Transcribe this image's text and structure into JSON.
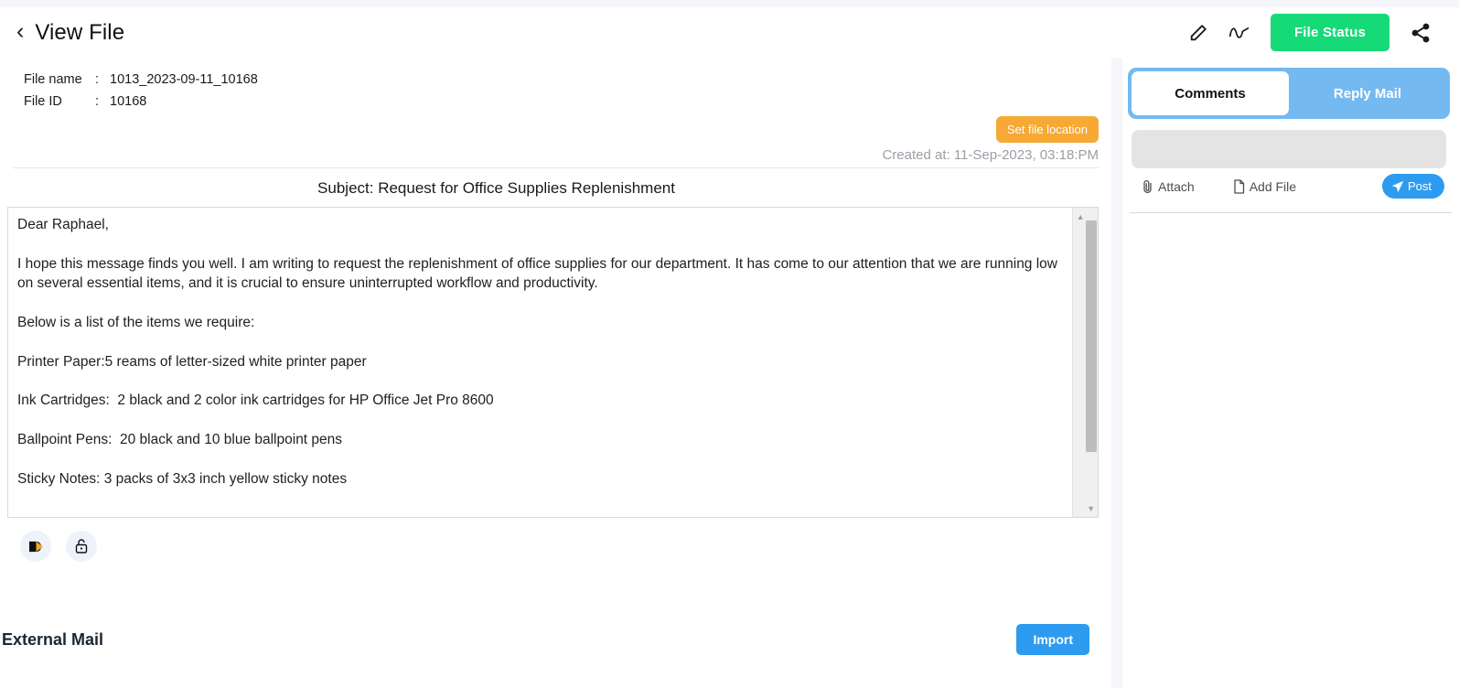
{
  "header": {
    "back_icon": "chevron-left-icon",
    "title": "View File",
    "edit_icon": "pencil-icon",
    "activity_icon": "activity-graph-icon",
    "file_status_label": "File Status",
    "share_icon": "share-icon",
    "accent_green": "#15da77"
  },
  "file_info": {
    "name_label": "File name",
    "name_value": "1013_2023-09-11_10168",
    "id_label": "File ID",
    "id_value": "10168",
    "colon": ":",
    "set_location_label": "Set file location",
    "set_location_color": "#f6a935",
    "created_at": "Created at: 11-Sep-2023, 03:18:PM"
  },
  "mail": {
    "subject": "Subject: Request for Office Supplies Replenishment",
    "body": "Dear Raphael,\n\nI hope this message finds you well. I am writing to request the replenishment of office supplies for our department. It has come to our attention that we are running low on several essential items, and it is crucial to ensure uninterrupted workflow and productivity.\n\nBelow is a list of the items we require:\n\nPrinter Paper:5 reams of letter-sized white printer paper\n\nInk Cartridges:  2 black and 2 color ink cartridges for HP Office Jet Pro 8600\n\nBallpoint Pens:  20 black and 10 blue ballpoint pens\n\nSticky Notes: 3 packs of 3x3 inch yellow sticky notes",
    "scroll_up_icon": "scroll-up-arrow-icon",
    "scroll_down_icon": "scroll-down-arrow-icon",
    "send_icon": "send-arrow-icon",
    "lock_icon": "unlocked-padlock-icon"
  },
  "footer": {
    "external_mail_label": "External Mail",
    "import_label": "Import",
    "import_color": "#2d9cf0"
  },
  "comments_panel": {
    "tabs": [
      {
        "label": "Comments",
        "active": true
      },
      {
        "label": "Reply Mail",
        "active": false
      }
    ],
    "input_value": "",
    "input_placeholder": "",
    "attach_label": "Attach",
    "attach_icon": "paperclip-icon",
    "add_file_label": "Add File",
    "add_file_icon": "file-icon",
    "post_label": "Post",
    "post_icon": "paper-plane-icon",
    "tab_bar_color": "#74b9f0"
  }
}
